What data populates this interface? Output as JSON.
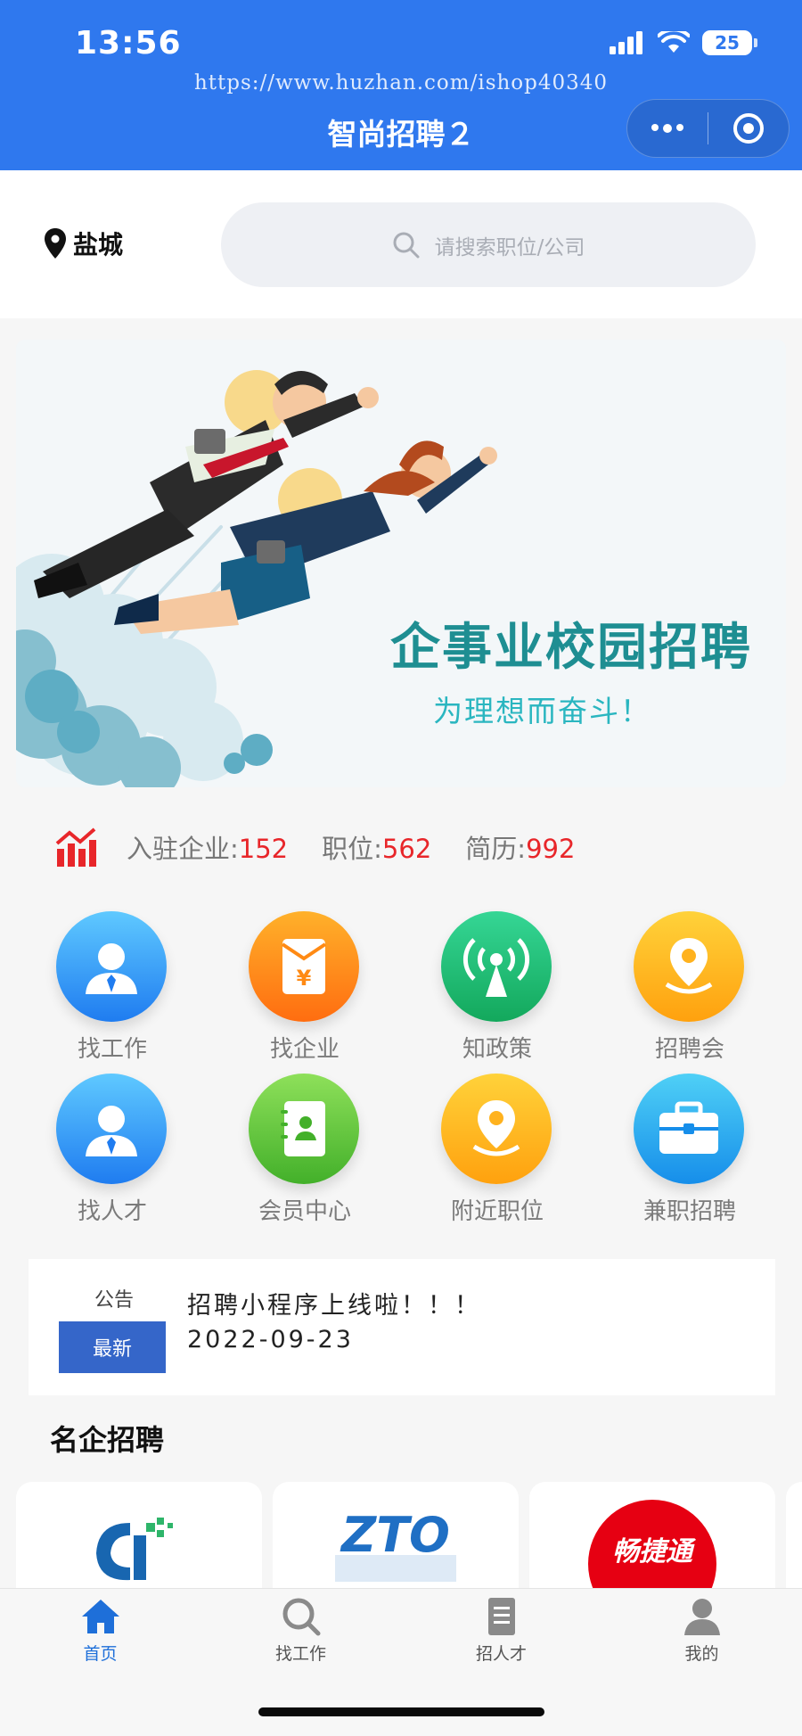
{
  "status_bar": {
    "time": "13:56",
    "battery": "25"
  },
  "header": {
    "watermark": "https://www.huzhan.com/ishop40340",
    "title": "智尚招聘２"
  },
  "location": {
    "city": "盐城"
  },
  "search": {
    "placeholder": "请搜索职位/公司"
  },
  "banner": {
    "title": "企事业校园招聘",
    "subtitle": "为理想而奋斗！"
  },
  "stats": [
    {
      "label": "入驻企业:",
      "value": "152"
    },
    {
      "label": "职位:",
      "value": "562"
    },
    {
      "label": "简历:",
      "value": "992"
    }
  ],
  "features": [
    {
      "label": "找工作",
      "icon": "user-tie-icon",
      "color": "#2f8af5"
    },
    {
      "label": "找企业",
      "icon": "yen-envelope-icon",
      "color": "#ff8a14"
    },
    {
      "label": "知政策",
      "icon": "broadcast-icon",
      "color": "#22c37a"
    },
    {
      "label": "招聘会",
      "icon": "location-pin-icon",
      "color": "#ffb21e"
    },
    {
      "label": "找人才",
      "icon": "user-tie-icon",
      "color": "#2f8af5"
    },
    {
      "label": "会员中心",
      "icon": "contact-book-icon",
      "color": "#6cc83a"
    },
    {
      "label": "附近职位",
      "icon": "location-pin-icon",
      "color": "#ffb21e"
    },
    {
      "label": "兼职招聘",
      "icon": "briefcase-icon",
      "color": "#1fa4ee"
    }
  ],
  "notice": {
    "tag": "公告",
    "button": "最新",
    "message": "招聘小程序上线啦！！！",
    "date": "2022-09-23"
  },
  "famous_companies": {
    "title": "名企招聘",
    "logos": [
      {
        "name": "company-logo-ci",
        "text": ""
      },
      {
        "name": "company-logo-zto",
        "text": "ZTO"
      },
      {
        "name": "company-logo-chanjet",
        "text": "畅捷通"
      }
    ]
  },
  "tabbar": [
    {
      "label": "首页",
      "icon": "home-icon",
      "active": true
    },
    {
      "label": "找工作",
      "icon": "search-icon",
      "active": false
    },
    {
      "label": "招人才",
      "icon": "document-icon",
      "active": false
    },
    {
      "label": "我的",
      "icon": "profile-icon",
      "active": false
    }
  ],
  "colors": {
    "primary": "#2f78ee",
    "accent_red": "#e8262a",
    "tab_active": "#1e6fd9"
  }
}
